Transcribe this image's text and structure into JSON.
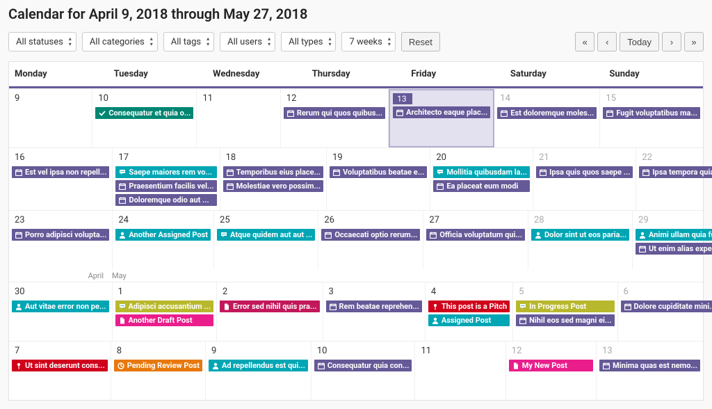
{
  "title": "Calendar for April 9, 2018 through May 27, 2018",
  "filters": {
    "statuses": "All statuses",
    "categories": "All categories",
    "tags": "All tags",
    "users": "All users",
    "types": "All types",
    "weeks": "7 weeks",
    "reset": "Reset"
  },
  "nav": {
    "first": "«",
    "prev": "‹",
    "today": "Today",
    "next": "›",
    "last": "»"
  },
  "week_headers": [
    "Monday",
    "Tuesday",
    "Wednesday",
    "Thursday",
    "Friday",
    "Saturday",
    "Sunday"
  ],
  "month_labels": {
    "left": "April",
    "right": "May"
  },
  "colors": {
    "purple": "#655997",
    "green": "#008672",
    "teal": "#00A6B4",
    "red": "#D0021B",
    "pink": "#E91E8C",
    "olive": "#B8B82E",
    "orange": "#E8780C",
    "magenta": "#C2185B"
  },
  "weeks": [
    {
      "days": [
        {
          "num": "9",
          "today": false,
          "other": false,
          "events": []
        },
        {
          "num": "10",
          "today": false,
          "other": false,
          "events": [
            {
              "label": "Consequatur et quia o...",
              "color": "green",
              "icon": "check"
            }
          ]
        },
        {
          "num": "11",
          "today": false,
          "other": false,
          "events": []
        },
        {
          "num": "12",
          "today": false,
          "other": false,
          "events": [
            {
              "label": "Rerum qui quos quibus...",
              "color": "purple",
              "icon": "calendar"
            }
          ]
        },
        {
          "num": "13",
          "today": true,
          "other": false,
          "events": [
            {
              "label": "Architecto eaque plac...",
              "color": "purple",
              "icon": "calendar"
            }
          ]
        },
        {
          "num": "14",
          "today": false,
          "other": true,
          "events": [
            {
              "label": "Est doloremque moles...",
              "color": "purple",
              "icon": "calendar"
            }
          ]
        },
        {
          "num": "15",
          "today": false,
          "other": true,
          "events": [
            {
              "label": "Fugit voluptatibus ma...",
              "color": "purple",
              "icon": "calendar"
            }
          ]
        }
      ]
    },
    {
      "days": [
        {
          "num": "16",
          "today": false,
          "other": false,
          "events": [
            {
              "label": "Est vel ipsa non repell...",
              "color": "purple",
              "icon": "calendar"
            }
          ]
        },
        {
          "num": "17",
          "today": false,
          "other": false,
          "events": [
            {
              "label": "Saepe maiores rem vo...",
              "color": "teal",
              "icon": "chat"
            },
            {
              "label": "Praesentium facilis vel...",
              "color": "purple",
              "icon": "calendar"
            },
            {
              "label": "Doloremque odio aut ...",
              "color": "purple",
              "icon": "calendar"
            }
          ]
        },
        {
          "num": "18",
          "today": false,
          "other": false,
          "events": [
            {
              "label": "Temporibus eius place...",
              "color": "purple",
              "icon": "calendar"
            },
            {
              "label": "Molestiae vero possim...",
              "color": "purple",
              "icon": "calendar"
            }
          ]
        },
        {
          "num": "19",
          "today": false,
          "other": false,
          "events": [
            {
              "label": "Voluptatibus beatae e...",
              "color": "purple",
              "icon": "calendar"
            }
          ]
        },
        {
          "num": "20",
          "today": false,
          "other": false,
          "events": [
            {
              "label": "Mollitia quibusdam la...",
              "color": "teal",
              "icon": "chat"
            },
            {
              "label": "Ea placeat eum modi",
              "color": "purple",
              "icon": "calendar"
            }
          ]
        },
        {
          "num": "21",
          "today": false,
          "other": true,
          "events": [
            {
              "label": "Ipsa quis quos saepe ...",
              "color": "purple",
              "icon": "calendar"
            }
          ]
        },
        {
          "num": "22",
          "today": false,
          "other": true,
          "events": [
            {
              "label": "Ipsa tempora quia et",
              "color": "purple",
              "icon": "calendar"
            }
          ]
        }
      ]
    },
    {
      "days": [
        {
          "num": "23",
          "today": false,
          "other": false,
          "events": [
            {
              "label": "Porro adipisci volupta...",
              "color": "purple",
              "icon": "calendar"
            }
          ]
        },
        {
          "num": "24",
          "today": false,
          "other": false,
          "events": [
            {
              "label": "Another Assigned Post",
              "color": "teal",
              "icon": "user"
            }
          ]
        },
        {
          "num": "25",
          "today": false,
          "other": false,
          "events": [
            {
              "label": "Atque quidem aut aut ...",
              "color": "teal",
              "icon": "chat"
            }
          ]
        },
        {
          "num": "26",
          "today": false,
          "other": false,
          "events": [
            {
              "label": "Occaecati optio rerum...",
              "color": "purple",
              "icon": "calendar"
            }
          ]
        },
        {
          "num": "27",
          "today": false,
          "other": false,
          "events": [
            {
              "label": "Officia voluptatum qui...",
              "color": "purple",
              "icon": "calendar"
            }
          ]
        },
        {
          "num": "28",
          "today": false,
          "other": true,
          "events": [
            {
              "label": "Dolor sint ut eos paria...",
              "color": "teal",
              "icon": "user"
            }
          ]
        },
        {
          "num": "29",
          "today": false,
          "other": true,
          "events": [
            {
              "label": "Animi ullam quia fugit ...",
              "color": "teal",
              "icon": "user"
            },
            {
              "label": "Ut enim alias expedita...",
              "color": "purple",
              "icon": "calendar"
            }
          ]
        }
      ]
    },
    {
      "month_break": true,
      "days": [
        {
          "num": "30",
          "today": false,
          "other": false,
          "events": [
            {
              "label": "Aut vitae error non pe...",
              "color": "teal",
              "icon": "user"
            }
          ]
        },
        {
          "num": "1",
          "today": false,
          "other": false,
          "events": [
            {
              "label": "Adipisci accusantium ...",
              "color": "olive",
              "icon": "chat"
            },
            {
              "label": "Another Draft Post",
              "color": "pink",
              "icon": "file"
            }
          ]
        },
        {
          "num": "2",
          "today": false,
          "other": false,
          "events": [
            {
              "label": "Error sed nihil quis pra...",
              "color": "magenta",
              "icon": "file"
            }
          ]
        },
        {
          "num": "3",
          "today": false,
          "other": false,
          "events": [
            {
              "label": "Rem beatae reprehen...",
              "color": "purple",
              "icon": "calendar"
            }
          ]
        },
        {
          "num": "4",
          "today": false,
          "other": false,
          "events": [
            {
              "label": "This post is a Pitch",
              "color": "red",
              "icon": "pin"
            },
            {
              "label": "Assigned Post",
              "color": "teal",
              "icon": "user"
            }
          ]
        },
        {
          "num": "5",
          "today": false,
          "other": true,
          "events": [
            {
              "label": "In Progress Post",
              "color": "olive",
              "icon": "chat"
            },
            {
              "label": "Nihil eos sed magni ei...",
              "color": "purple",
              "icon": "calendar"
            }
          ]
        },
        {
          "num": "6",
          "today": false,
          "other": true,
          "events": [
            {
              "label": "Dolore cupiditate mini...",
              "color": "purple",
              "icon": "calendar"
            }
          ]
        }
      ]
    },
    {
      "days": [
        {
          "num": "7",
          "today": false,
          "other": false,
          "events": [
            {
              "label": "Ut sint deserunt cons...",
              "color": "red",
              "icon": "pin"
            }
          ]
        },
        {
          "num": "8",
          "today": false,
          "other": false,
          "events": [
            {
              "label": "Pending Review Post",
              "color": "orange",
              "icon": "clock"
            }
          ]
        },
        {
          "num": "9",
          "today": false,
          "other": false,
          "events": [
            {
              "label": "Ad repellendus est qui...",
              "color": "teal",
              "icon": "user"
            }
          ]
        },
        {
          "num": "10",
          "today": false,
          "other": false,
          "events": [
            {
              "label": "Consequatur quia con...",
              "color": "purple",
              "icon": "calendar"
            }
          ]
        },
        {
          "num": "11",
          "today": false,
          "other": false,
          "events": []
        },
        {
          "num": "12",
          "today": false,
          "other": true,
          "events": [
            {
              "label": "My New Post",
              "color": "pink",
              "icon": "file"
            }
          ]
        },
        {
          "num": "13",
          "today": false,
          "other": true,
          "events": [
            {
              "label": "Minima quas est nemo...",
              "color": "purple",
              "icon": "calendar"
            }
          ]
        }
      ]
    }
  ]
}
